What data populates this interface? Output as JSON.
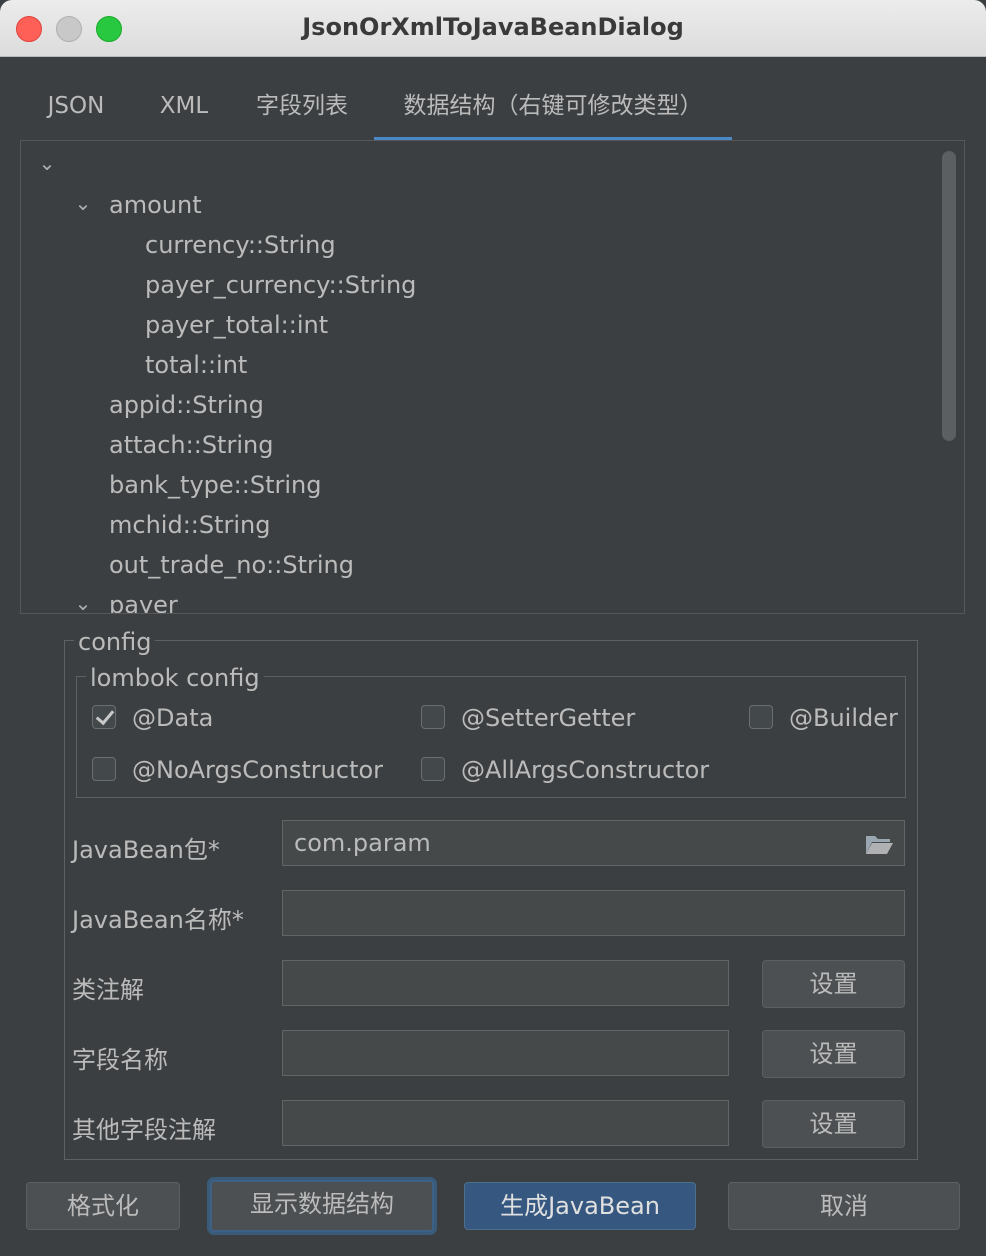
{
  "window": {
    "title": "JsonOrXmlToJavaBeanDialog"
  },
  "tabs": [
    {
      "label": "JSON"
    },
    {
      "label": "XML"
    },
    {
      "label": "字段列表"
    },
    {
      "label": "数据结构（右键可修改类型）"
    }
  ],
  "tree": {
    "nodes": [
      {
        "label": "amount"
      },
      {
        "label": "currency::String"
      },
      {
        "label": "payer_currency::String"
      },
      {
        "label": "payer_total::int"
      },
      {
        "label": "total::int"
      },
      {
        "label": "appid::String"
      },
      {
        "label": "attach::String"
      },
      {
        "label": "bank_type::String"
      },
      {
        "label": "mchid::String"
      },
      {
        "label": "out_trade_no::String"
      },
      {
        "label": "payer"
      }
    ]
  },
  "config": {
    "title": "config",
    "lombok": {
      "title": "lombok config",
      "options": [
        {
          "label": "@Data",
          "checked": true
        },
        {
          "label": "@SetterGetter",
          "checked": false
        },
        {
          "label": "@Builder",
          "checked": false
        },
        {
          "label": "@NoArgsConstructor",
          "checked": false
        },
        {
          "label": "@AllArgsConstructor",
          "checked": false
        }
      ]
    },
    "package_label": "JavaBean包*",
    "package_value": "com.param",
    "name_label": "JavaBean名称*",
    "name_value": "",
    "class_annotation_label": "类注解",
    "field_name_label": "字段名称",
    "other_annotation_label": "其他字段注解",
    "settings_button": "设置"
  },
  "footer": {
    "format_button": "格式化",
    "show_structure_button": "显示数据结构",
    "generate_button": "生成JavaBean",
    "cancel_button": "取消"
  },
  "colors": {
    "accent": "#4a88c7",
    "background": "#3c3f41",
    "primary_button": "#365880"
  }
}
